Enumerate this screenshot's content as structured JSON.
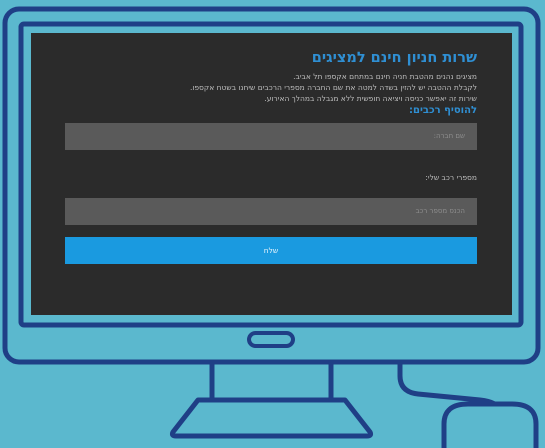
{
  "form": {
    "title": "שרות חניון חינם למציגים",
    "paragraph_lines": [
      "מציגים נהנים מהטבת חניה חינם במתחם אקספו תל אביב.",
      "לקבלת ההטבה יש להזין בשדה למטה את שם החברה מספרי הרכבים שיחנו בשטח אקספו.",
      "שירות זה יאפשר כניסה ויציאה חופשית ללא מגבלה במהלך האירוע."
    ],
    "add_vehicles_heading": "להוסיף רכבים:",
    "company_placeholder": "שם חברה:",
    "plates_label": "מספרי רכב שלי:",
    "plate_placeholder": "הכנס מספר רכב",
    "submit_label": "שלח"
  },
  "colors": {
    "background": "#5bb8ce",
    "screen": "#2b2b2b",
    "accent": "#2f8fd3",
    "button": "#1a9ae0",
    "outline": "#1f3f86"
  },
  "icons": [
    "monitor-illustration",
    "computer-mouse-icon"
  ]
}
